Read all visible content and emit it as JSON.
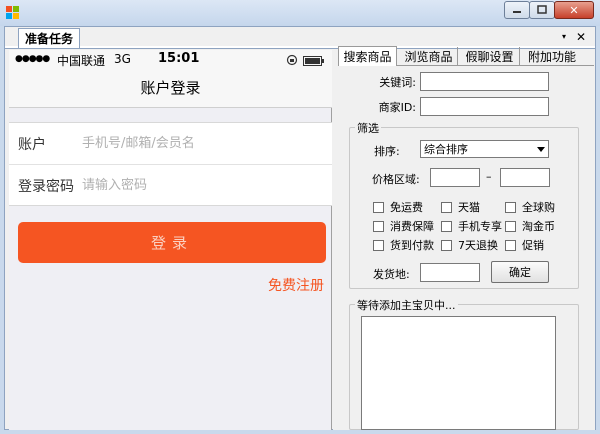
{
  "document": {
    "tab_label": "准备任务",
    "menu_glyph": "▾",
    "close_glyph": "✕"
  },
  "window": {
    "close_glyph": "✕"
  },
  "phone": {
    "status": {
      "signal": "●●●●●",
      "carrier": "中国联通",
      "network": "3G",
      "time": "15:01"
    },
    "title": "账户登录",
    "account": {
      "label": "账户",
      "placeholder": "手机号/邮箱/会员名"
    },
    "password": {
      "label": "登录密码",
      "placeholder": "请输入密码"
    },
    "login_label": "登录",
    "register_label": "免费注册",
    "accent_color": "#f55522"
  },
  "right": {
    "tabs": [
      {
        "label": "搜索商品",
        "active": true
      },
      {
        "label": "浏览商品",
        "active": false
      },
      {
        "label": "假聊设置",
        "active": false
      },
      {
        "label": "附加功能",
        "active": false
      }
    ],
    "keyword": {
      "label": "关键词:",
      "value": ""
    },
    "shop_id": {
      "label": "商家ID:",
      "value": ""
    },
    "filter": {
      "legend": "筛选",
      "sort": {
        "label": "排序:",
        "selected": "综合排序"
      },
      "price": {
        "label": "价格区域:",
        "min": "",
        "max": "",
        "dash": "–"
      },
      "checkboxes": [
        {
          "label": "免运费",
          "checked": false
        },
        {
          "label": "天猫",
          "checked": false
        },
        {
          "label": "全球购",
          "checked": false
        },
        {
          "label": "消费保障",
          "checked": false
        },
        {
          "label": "手机专享",
          "checked": false
        },
        {
          "label": "淘金币",
          "checked": false
        },
        {
          "label": "货到付款",
          "checked": false
        },
        {
          "label": "7天退换",
          "checked": false
        },
        {
          "label": "促销",
          "checked": false
        }
      ],
      "ship_from": {
        "label": "发货地:",
        "value": ""
      },
      "confirm_label": "确定"
    },
    "waiting": {
      "legend": "等待添加主宝贝中..."
    }
  }
}
